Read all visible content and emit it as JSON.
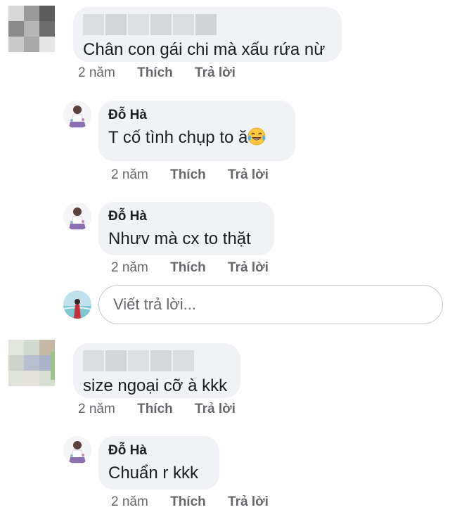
{
  "comments": [
    {
      "id": "c1",
      "author_redacted": true,
      "text": "Chân con gái chi mà xấu rứa nừ",
      "time": "2 năm",
      "like_label": "Thích",
      "reply_label": "Trả lời"
    },
    {
      "id": "r1",
      "author": "Đỗ Hà",
      "text": "T cố tình chụp to ă",
      "emoji": "tears-of-joy-emoji",
      "time": "2 năm",
      "like_label": "Thích",
      "reply_label": "Trả lời"
    },
    {
      "id": "r2",
      "author": "Đỗ Hà",
      "text": "Nhưv mà cx to thặt",
      "time": "2 năm",
      "like_label": "Thích",
      "reply_label": "Trả lời"
    },
    {
      "id": "c2",
      "author_redacted": true,
      "text": "size ngoại cỡ à kkk",
      "time": "2 năm",
      "like_label": "Thích",
      "reply_label": "Trả lời"
    },
    {
      "id": "r3",
      "author": "Đỗ Hà",
      "text": "Chuẩn r kkk",
      "time": "2 năm",
      "like_label": "Thích",
      "reply_label": "Trả lời"
    }
  ],
  "reply_box": {
    "placeholder": "Viết trả lời..."
  },
  "colors": {
    "bubble": "#f0f2f5",
    "meta_text": "#65676b",
    "border": "#c6c8cc"
  }
}
